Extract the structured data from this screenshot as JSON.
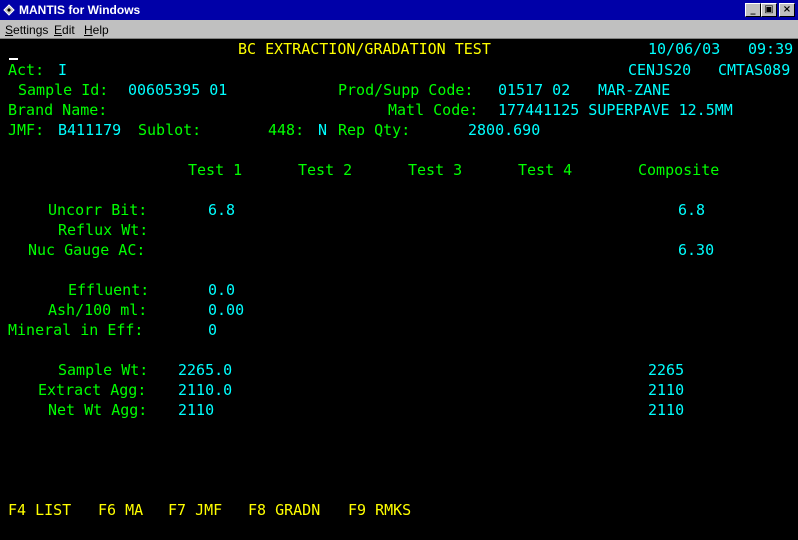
{
  "window": {
    "title": "MANTIS for Windows",
    "min_glyph": "_",
    "max_glyph": "▣",
    "close_glyph": "×"
  },
  "menu": {
    "items": [
      {
        "underline": "S",
        "rest": "ettings"
      },
      {
        "underline": "E",
        "rest": "dit"
      },
      {
        "underline": "H",
        "rest": "elp"
      }
    ]
  },
  "screen": {
    "title": "BC EXTRACTION/GRADATION TEST",
    "date": "10/06/03",
    "time": "09:39",
    "act_label": "Act:",
    "act_value": "I",
    "ids": "CENJS20",
    "ids2": "CMTAS089",
    "sample_id_label": "Sample Id:",
    "sample_id_value": "00605395 01",
    "prod_supp_label": "Prod/Supp Code:",
    "prod_supp_value": "01517 02",
    "supplier": "MAR-ZANE",
    "brand_label": "Brand Name:",
    "matl_label": "Matl Code:",
    "matl_value": "177441125 SUPERPAVE 12.5MM",
    "jmf_label": "JMF:",
    "jmf_value": "B411179",
    "sublot_label": "Sublot:",
    "c448_label": "448:",
    "c448_value": "N",
    "repqty_label": "Rep Qty:",
    "repqty_value": "2800.690"
  },
  "columns": {
    "test1": "Test 1",
    "test2": "Test 2",
    "test3": "Test 3",
    "test4": "Test 4",
    "composite": "Composite"
  },
  "rows": {
    "uncorr_bit": {
      "label": "Uncorr Bit:",
      "test1": "6.8",
      "composite": "6.8"
    },
    "reflux_wt": {
      "label": "Reflux Wt:"
    },
    "nuc_gauge": {
      "label": "Nuc Gauge AC:",
      "composite": "6.30"
    },
    "effluent": {
      "label": "Effluent:",
      "test1": "0.0"
    },
    "ash": {
      "label": "Ash/100 ml:",
      "test1": "0.00"
    },
    "mineral": {
      "label": "Mineral in Eff:",
      "test1": "0"
    },
    "sample_wt": {
      "label": "Sample Wt:",
      "test1": "2265.0",
      "composite": "2265"
    },
    "extract_agg": {
      "label": "Extract Agg:",
      "test1": "2110.0",
      "composite": "2110"
    },
    "net_wt_agg": {
      "label": "Net Wt Agg:",
      "test1": "2110",
      "composite": "2110"
    }
  },
  "function_keys": {
    "f4": "F4 LIST",
    "f6": "F6 MA",
    "f7": "F7 JMF",
    "f8": "F8 GRADN",
    "f9": "F9 RMKS"
  },
  "colors": {
    "background": "#000000",
    "title_bar": "#0000a8",
    "label": "#00ff00",
    "value": "#00ffff",
    "heading": "#ffff00"
  },
  "icons": {
    "app": "mantis-app-icon"
  }
}
